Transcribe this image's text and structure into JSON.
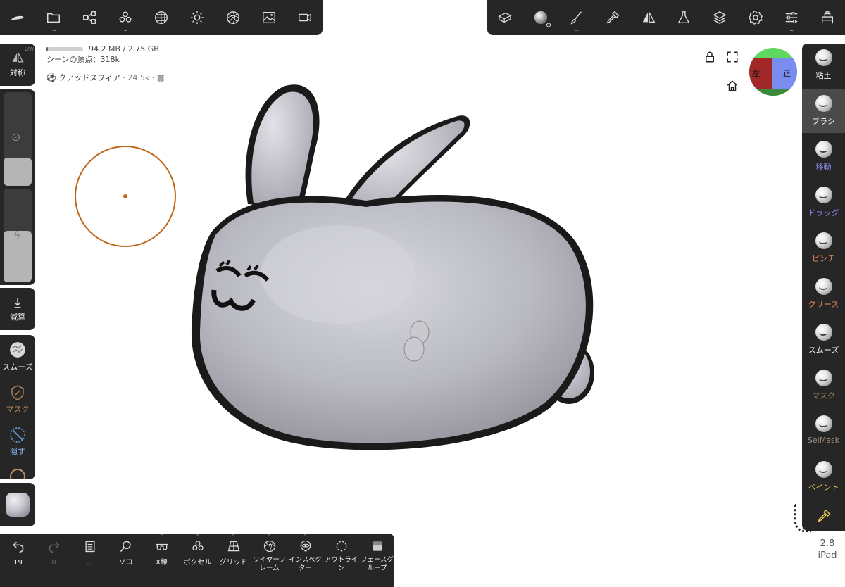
{
  "top_left_toolbar": [
    {
      "name": "nomad-logo-icon",
      "dots": ""
    },
    {
      "name": "folder-icon",
      "dots": "..."
    },
    {
      "name": "scene-graph-icon",
      "dots": ""
    },
    {
      "name": "multires-icon",
      "dots": "..."
    },
    {
      "name": "topology-icon",
      "dots": ""
    },
    {
      "name": "light-icon",
      "dots": ""
    },
    {
      "name": "render-icon",
      "dots": ""
    },
    {
      "name": "image-icon",
      "dots": ""
    },
    {
      "name": "camera-icon",
      "dots": ""
    }
  ],
  "top_right_toolbar": [
    {
      "name": "material-box-icon",
      "dots": ""
    },
    {
      "name": "matcap-ball-icon",
      "dots": ""
    },
    {
      "name": "paint-brush-icon",
      "dots": "..."
    },
    {
      "name": "picker-icon",
      "dots": ""
    },
    {
      "name": "symmetry-icon",
      "dots": ""
    },
    {
      "name": "flask-icon",
      "dots": ""
    },
    {
      "name": "layers-icon",
      "dots": ""
    },
    {
      "name": "settings-icon",
      "dots": ""
    },
    {
      "name": "sliders-icon",
      "dots": "..."
    },
    {
      "name": "interface-icon",
      "dots": ""
    }
  ],
  "info": {
    "memory": "94.2 MB / 2.75 GB",
    "memory_fraction": 0.034,
    "vertices": "シーンの頂点：318k",
    "object_name": "クアッドスフィア",
    "object_count": "· 24.5k ·"
  },
  "left_panel": {
    "symmetry_label": "対称",
    "symmetry_badge": "L/W",
    "radius_fraction": 0.35,
    "intensity_fraction": 0.55,
    "subtract_label": "減算",
    "smooth_label": "スムーズ",
    "mask_label": "マスク",
    "hide_label": "隠す"
  },
  "right_tools": [
    {
      "label": "粘土",
      "color": "#ffffff",
      "active": false
    },
    {
      "label": "ブラシ",
      "color": "#ffffff",
      "active": true
    },
    {
      "label": "移動",
      "color": "#8e8ef0",
      "active": false
    },
    {
      "label": "ドラッグ",
      "color": "#8e8ef0",
      "active": false
    },
    {
      "label": "ピンチ",
      "color": "#f08c5a",
      "active": false
    },
    {
      "label": "クリース",
      "color": "#f08c5a",
      "active": false
    },
    {
      "label": "スムーズ",
      "color": "#ffffff",
      "active": false
    },
    {
      "label": "マスク",
      "color": "#a08060",
      "active": false
    },
    {
      "label": "SelMask",
      "color": "#a09080",
      "active": false
    },
    {
      "label": "ペイント",
      "color": "#e8c84a",
      "active": false
    }
  ],
  "bottom_bar": [
    {
      "name": "undo-icon",
      "label": "19",
      "caret": false
    },
    {
      "name": "redo-icon",
      "label": "0",
      "caret": false
    },
    {
      "name": "history-icon",
      "label": "...",
      "caret": false
    },
    {
      "name": "solo-icon",
      "label": "ソロ",
      "caret": false
    },
    {
      "name": "xray-icon",
      "label": "X線",
      "caret": true
    },
    {
      "name": "voxel-icon",
      "label": "ボクセル",
      "caret": true
    },
    {
      "name": "grid-icon",
      "label": "グリッド",
      "caret": true
    },
    {
      "name": "wireframe-icon",
      "label": "ワイヤーフレーム",
      "caret": true
    },
    {
      "name": "inspector-icon",
      "label": "インスペクター",
      "caret": true
    },
    {
      "name": "outline-icon",
      "label": "アウトライン",
      "caret": false
    },
    {
      "name": "facegroup-icon",
      "label": "フェースグループ",
      "caret": false
    }
  ],
  "gizmo": {
    "left_label": "左",
    "front_label": "正"
  },
  "version": {
    "number": "2.8",
    "device": "iPad"
  },
  "colors": {
    "panel": "#262626",
    "cursor": "#c0661a",
    "accent_active": "#4a4a4a"
  }
}
